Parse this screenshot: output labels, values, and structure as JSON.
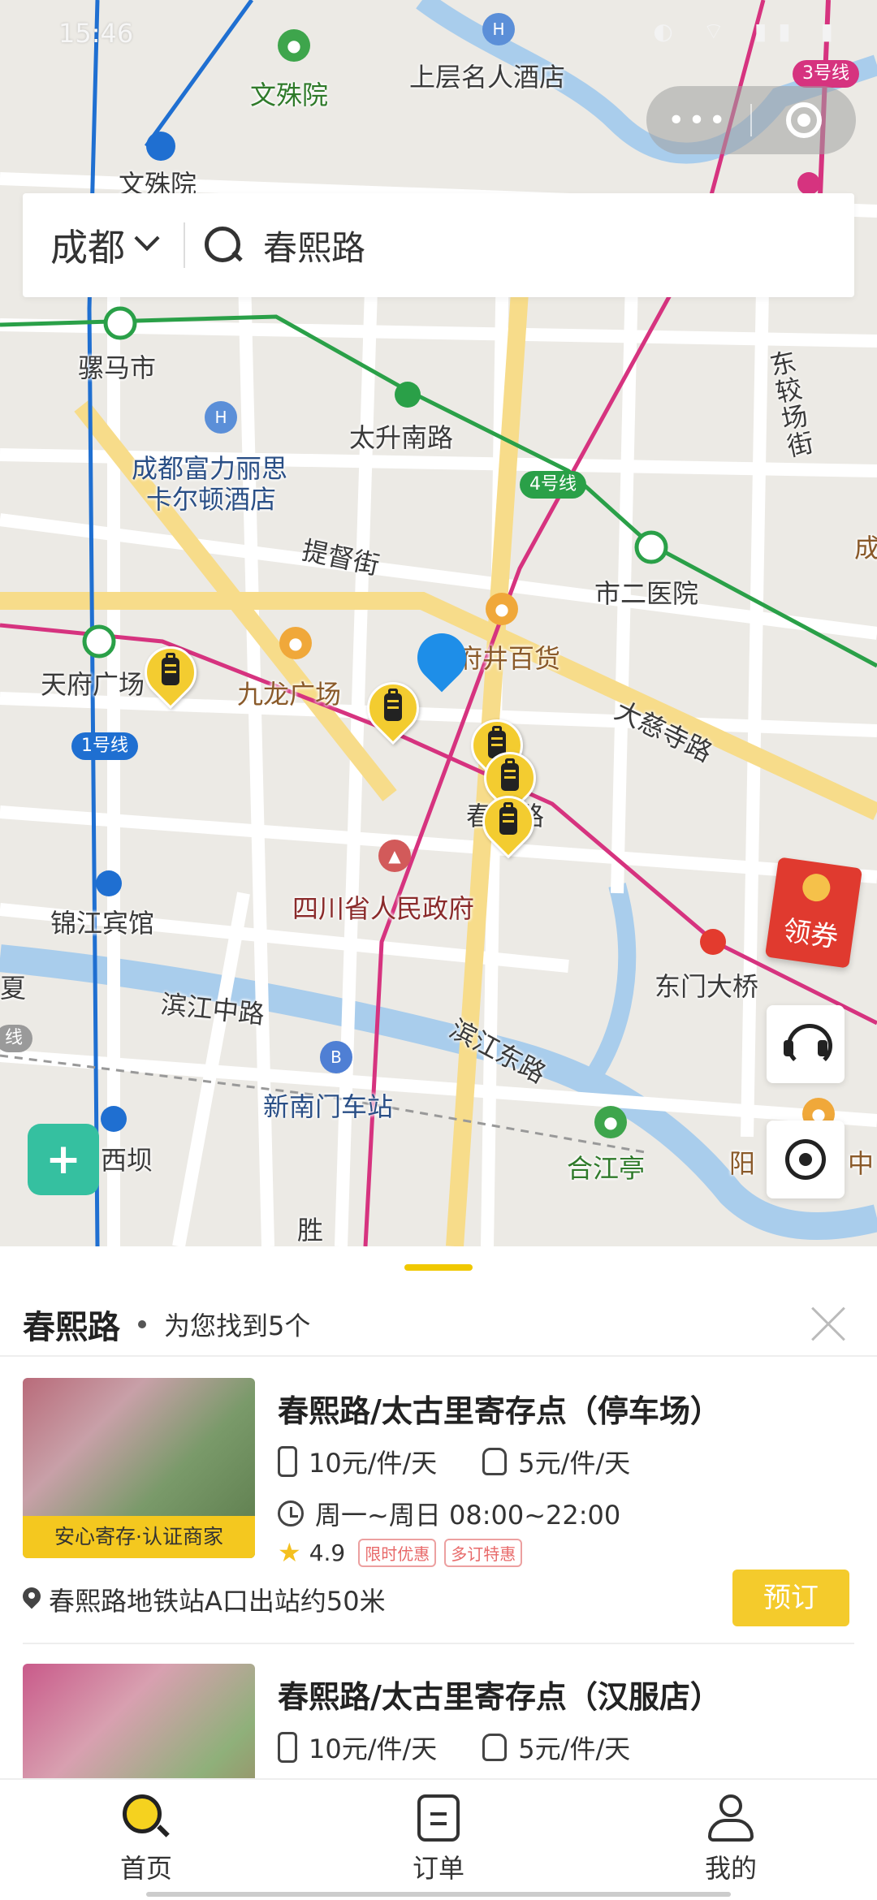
{
  "status_bar": {
    "time": "15:46",
    "icons": "◐ ⌔ ▮▮ ▮"
  },
  "capsule": {
    "more": "•••"
  },
  "search": {
    "city": "成都",
    "query": "春熙路"
  },
  "map": {
    "labels": {
      "wenshuyuan_poi": "文殊院",
      "wenshuyuan_station": "文殊院",
      "hotel_top": "上层名人酒店",
      "luomashi": "骡马市",
      "taishengnanlu": "太升南路",
      "ritz_1": "成都富力丽思",
      "ritz_2": "卡尔顿酒店",
      "tidujie": "提督街",
      "shiereryiyuan": "市二医院",
      "dongjiaochangjie": "东较场街",
      "tianfuguangchang": "天府广场",
      "jiulongguangchang": "九龙广场",
      "wangfujing": "王府井百货",
      "daci": "大慈寺路",
      "chunxilu": "春熙路",
      "sichuan_gov": "四川省人民政府",
      "jinjiangbinguan": "锦江宾馆",
      "dongmendaqiao": "东门大桥",
      "binjiangzhonglu": "滨江中路",
      "binjiangdonglu": "滨江东路",
      "xinnanmen": "新南门车站",
      "hejiangting": "合江亭",
      "xiba": "西坝",
      "sheng": "胜",
      "yang": "阳",
      "zhong": "中",
      "cheng": "成",
      "xia": "夏",
      "xian": "线"
    },
    "line_badges": {
      "line3": "3号线",
      "line4": "4号线",
      "line1": "1号线"
    },
    "coupon": "领券"
  },
  "sheet": {
    "title": "春熙路",
    "found_text": "为您找到5个",
    "items": [
      {
        "title": "春熙路/太古里寄存点（停车场）",
        "price_large": "10元/件/天",
        "price_small": "5元/件/天",
        "hours": "周一~周日 08:00~22:00",
        "rating": "4.9",
        "tags": [
          "限时优惠",
          "多订特惠"
        ],
        "badge": "安心寄存·认证商家",
        "address": "春熙路地铁站A口出站约50米",
        "book_label": "预订"
      },
      {
        "title": "春熙路/太古里寄存点（汉服店）",
        "price_large": "10元/件/天",
        "price_small": "5元/件/天"
      }
    ]
  },
  "tabbar": {
    "tabs": [
      {
        "label": "首页",
        "icon": "search-icon"
      },
      {
        "label": "订单",
        "icon": "order-icon"
      },
      {
        "label": "我的",
        "icon": "user-icon"
      }
    ]
  },
  "colors": {
    "accent": "#f4cb2c",
    "line1": "#1f6fd1",
    "line4": "#2aa048",
    "line3": "#d6337f"
  }
}
